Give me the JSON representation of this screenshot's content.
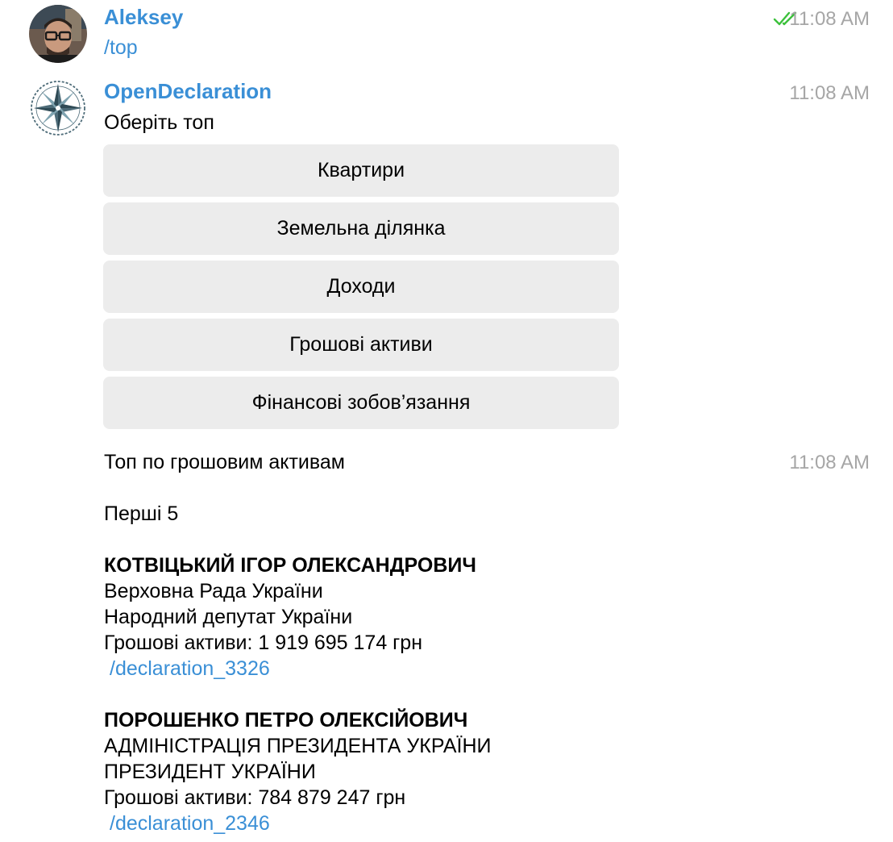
{
  "messages": {
    "user_message": {
      "sender": "Aleksey",
      "text": "/top",
      "time": "11:08 AM",
      "status_icon": "double-check-icon",
      "status_color": "#3cc13c"
    },
    "bot_menu": {
      "sender": "OpenDeclaration",
      "text": "Оберіть топ",
      "time": "11:08 AM",
      "buttons": [
        "Квартири",
        "Земельна ділянка",
        "Доходи",
        "Грошові активи",
        "Фінансові зобов’язання"
      ]
    },
    "bot_result": {
      "time": "11:08 AM",
      "heading": "Топ по грошовим активам",
      "subheading": "Перші 5",
      "entries": [
        {
          "name": "КОТВІЦЬКИЙ ІГОР ОЛЕКСАНДРОВИЧ",
          "organization": "Верховна Рада України",
          "position": "Народний депутат України",
          "assets": "Грошові активи: 1 919 695 174 грн",
          "link": "/declaration_3326"
        },
        {
          "name": "ПОРОШЕНКО ПЕТРО ОЛЕКСІЙОВИЧ",
          "organization": "АДМІНІСТРАЦІЯ ПРЕЗИДЕНТА УКРАЇНИ",
          "position": "ПРЕЗИДЕНТ УКРАЇНИ",
          "assets": "Грошові активи: 784 879 247 грн",
          "link": "/declaration_2346"
        }
      ]
    }
  },
  "colors": {
    "accent": "#3a8fd6",
    "timestamp": "#a6a6a6",
    "button_bg": "#ececec"
  }
}
